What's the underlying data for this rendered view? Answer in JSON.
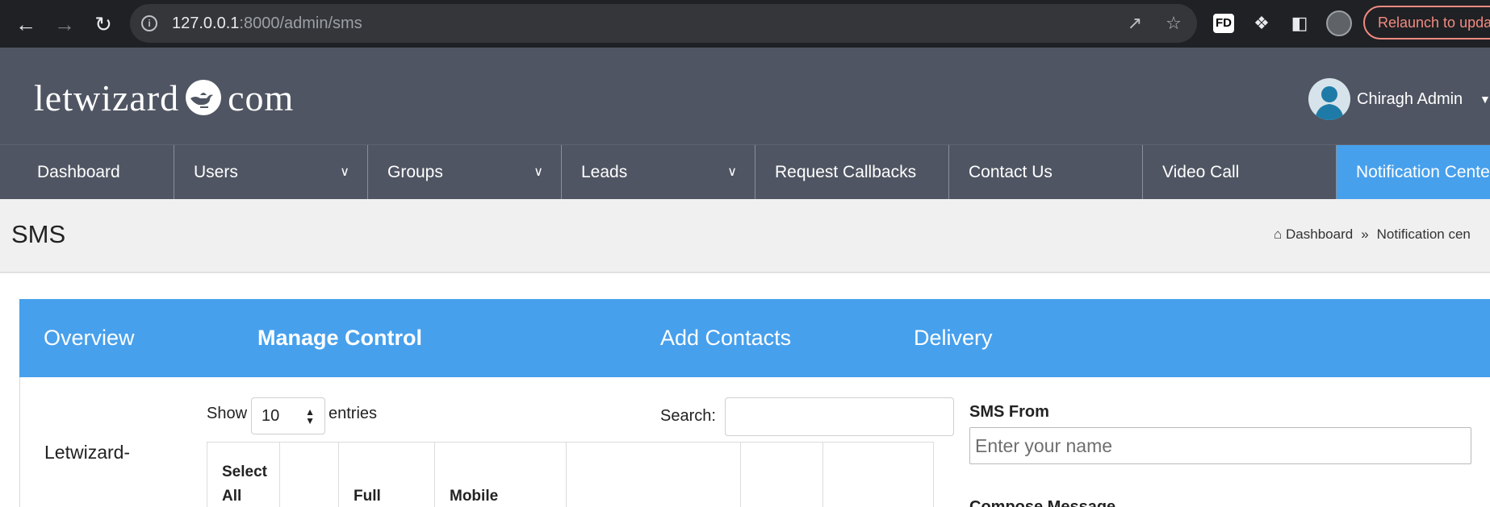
{
  "browser": {
    "url_host": "127.0.0.1",
    "url_rest": ":8000/admin/sms",
    "relaunch_label": "Relaunch to upda",
    "extension_fd": "FD"
  },
  "header": {
    "logo_left": "letwizard",
    "logo_right": "com",
    "user_name": "Chiragh Admin"
  },
  "nav": {
    "items": [
      {
        "label": "Dashboard"
      },
      {
        "label": "Users"
      },
      {
        "label": "Groups"
      },
      {
        "label": "Leads"
      },
      {
        "label": "Request Callbacks"
      },
      {
        "label": "Contact Us"
      },
      {
        "label": "Video Call"
      },
      {
        "label": "Notification Cente"
      }
    ]
  },
  "page": {
    "title": "SMS",
    "breadcrumb": {
      "home": "Dashboard",
      "separator": "»",
      "current": "Notification cen"
    }
  },
  "tabs": [
    {
      "label": "Overview"
    },
    {
      "label": "Manage Control"
    },
    {
      "label": "Add Contacts"
    },
    {
      "label": "Delivery"
    }
  ],
  "sidebar": {
    "label": "Letwizard-"
  },
  "table": {
    "show_label": "Show",
    "page_length": "10",
    "entries_label": "entries",
    "search_label": "Search:",
    "columns": [
      "Select All",
      "",
      "Full",
      "Mobile",
      "",
      "",
      ""
    ]
  },
  "form": {
    "sms_from_label": "SMS From",
    "sms_from_placeholder": "Enter your name",
    "compose_label": "Compose Message"
  },
  "colors": {
    "header_bg": "#4f5562",
    "accent": "#47a0ec",
    "chrome_bg": "#202124"
  }
}
